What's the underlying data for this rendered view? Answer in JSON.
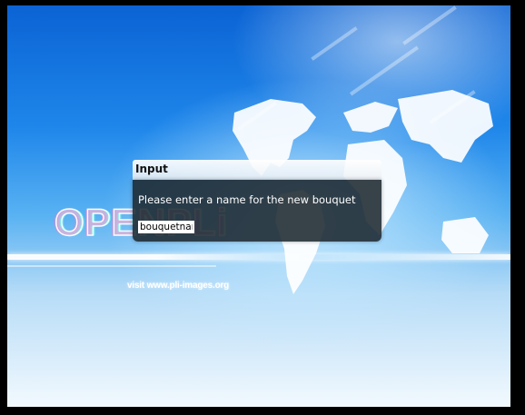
{
  "background": {
    "logo_text": "OPENPLi",
    "visit_text": "visit www.pli-images.org"
  },
  "dialog": {
    "title": "Input",
    "prompt": "Please enter a name for the new bouquet",
    "input_value": "bouquetname"
  },
  "colors": {
    "dialog_body": "#1c2830",
    "sky_top": "#0b63d4",
    "sky_bottom": "#f2f9fe"
  }
}
